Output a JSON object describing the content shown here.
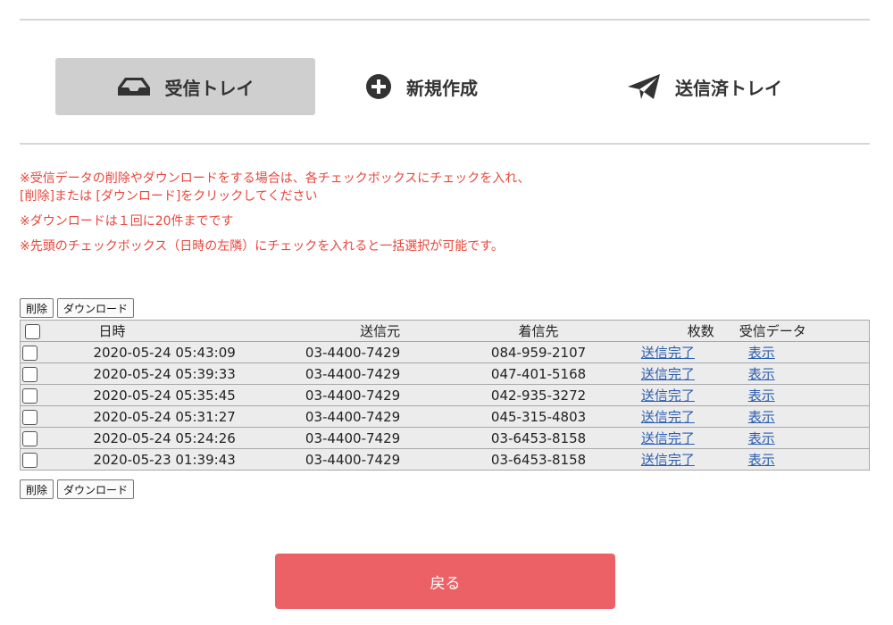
{
  "tabs": {
    "inbox": {
      "label": "受信トレイ",
      "icon": "inbox-icon"
    },
    "compose": {
      "label": "新規作成",
      "icon": "plus-circle-icon"
    },
    "sent": {
      "label": "送信済トレイ",
      "icon": "paper-plane-icon"
    }
  },
  "notes": {
    "line1": "※受信データの削除やダウンロードをする場合は、各チェックボックスにチェックを入れ、",
    "line2": "[削除]または [ダウンロード]をクリックしてください",
    "line3": "※ダウンロードは１回に20件までです",
    "line4": "※先頭のチェックボックス（日時の左隣）にチェックを入れると一括選択が可能です。"
  },
  "actions": {
    "delete_label": "削除",
    "download_label": "ダウンロード"
  },
  "table": {
    "headers": {
      "date": "日時",
      "from": "送信元",
      "to": "着信先",
      "pages": "枚数",
      "data": "受信データ"
    },
    "rows": [
      {
        "date": "2020-05-24 05:43:09",
        "from": "03-4400-7429",
        "to": "084-959-2107",
        "status": "送信完了",
        "view": "表示"
      },
      {
        "date": "2020-05-24 05:39:33",
        "from": "03-4400-7429",
        "to": "047-401-5168",
        "status": "送信完了",
        "view": "表示"
      },
      {
        "date": "2020-05-24 05:35:45",
        "from": "03-4400-7429",
        "to": "042-935-3272",
        "status": "送信完了",
        "view": "表示"
      },
      {
        "date": "2020-05-24 05:31:27",
        "from": "03-4400-7429",
        "to": "045-315-4803",
        "status": "送信完了",
        "view": "表示"
      },
      {
        "date": "2020-05-24 05:24:26",
        "from": "03-4400-7429",
        "to": "03-6453-8158",
        "status": "送信完了",
        "view": "表示"
      },
      {
        "date": "2020-05-23 01:39:43",
        "from": "03-4400-7429",
        "to": "03-6453-8158",
        "status": "送信完了",
        "view": "表示"
      }
    ]
  },
  "back_button": {
    "label": "戻る"
  },
  "colors": {
    "notice_red": "#e8463c",
    "back_button": "#ec6166",
    "active_tab": "#cfcfcf",
    "link": "#2a5db0"
  }
}
